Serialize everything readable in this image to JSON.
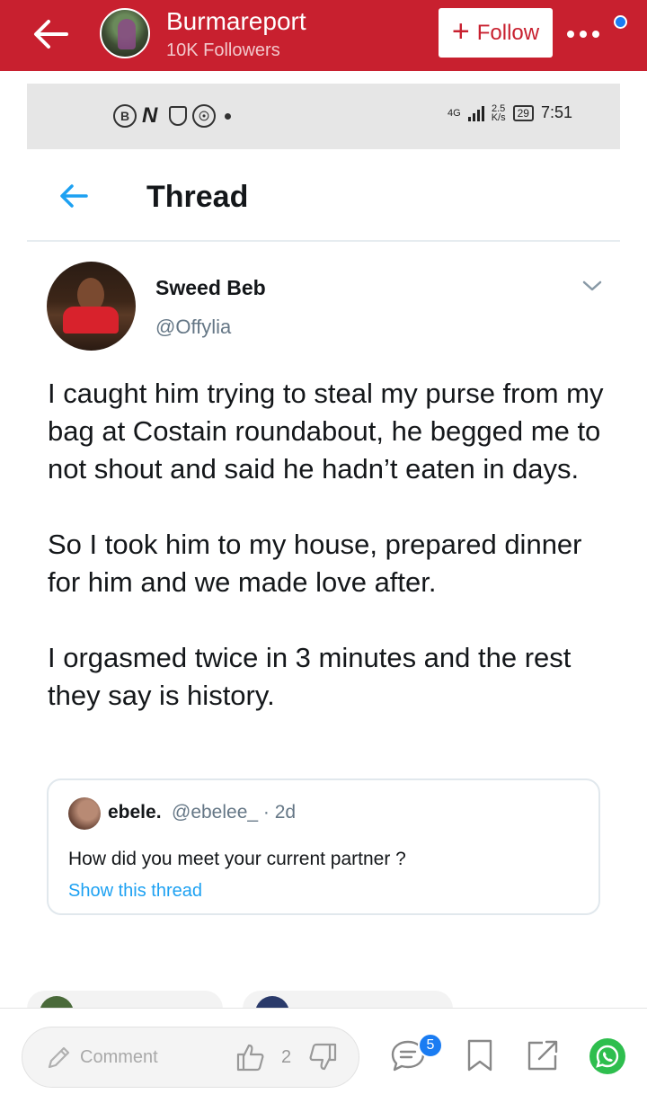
{
  "app_bar": {
    "title": "Burmareport",
    "followers": "10K Followers",
    "follow_label": "Follow",
    "follow_plus": "+",
    "accent_color": "#c8202f"
  },
  "status_bar": {
    "left_icons": [
      "B",
      "N"
    ],
    "network": "4G",
    "speed_top": "2.5",
    "speed_bottom": "K/s",
    "battery": "29",
    "time": "7:51"
  },
  "thread": {
    "title": "Thread"
  },
  "tweet": {
    "name": "Sweed Beb",
    "handle": "@Offylia",
    "paragraphs": [
      "I caught him trying to steal my purse from my bag at Costain roundabout, he begged me to not shout and said he hadn’t eaten in days.",
      "So I took him to my house, prepared dinner for him and we made love after.",
      "I orgasmed twice in 3 minutes and the rest they say is history."
    ]
  },
  "quote": {
    "name": "ebele.",
    "meta": "@ebelee_ · 2d",
    "text": "How did you meet your current partner ?",
    "link": "Show this thread"
  },
  "bottom_bar": {
    "comment_placeholder": "Comment",
    "like_count": "2",
    "comments_badge": "5",
    "icons": [
      "pencil-icon",
      "thumbs-up-icon",
      "thumbs-down-icon",
      "comment-icon",
      "bookmark-icon",
      "share-icon",
      "whatsapp-icon"
    ]
  }
}
